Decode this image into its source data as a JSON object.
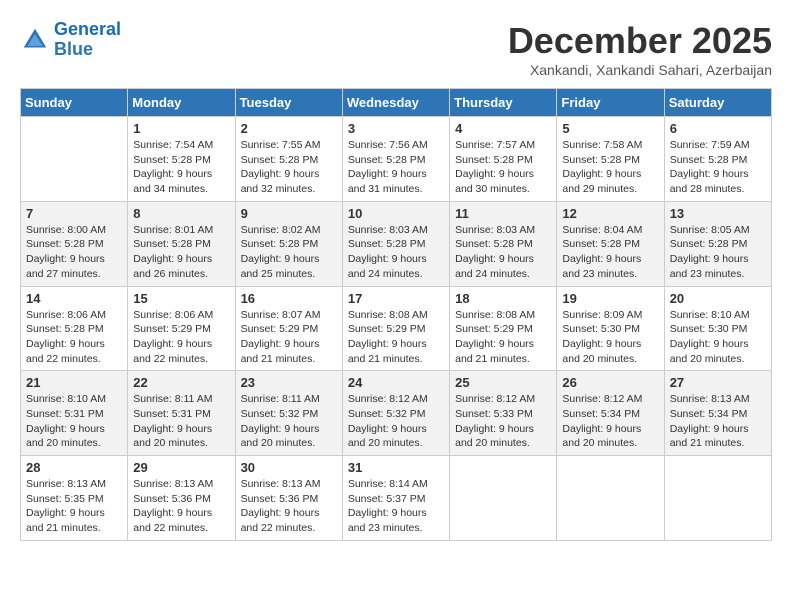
{
  "header": {
    "logo_line1": "General",
    "logo_line2": "Blue",
    "month": "December 2025",
    "location": "Xankandi, Xankandi Sahari, Azerbaijan"
  },
  "weekdays": [
    "Sunday",
    "Monday",
    "Tuesday",
    "Wednesday",
    "Thursday",
    "Friday",
    "Saturday"
  ],
  "weeks": [
    [
      {
        "day": "",
        "sunrise": "",
        "sunset": "",
        "daylight": ""
      },
      {
        "day": "1",
        "sunrise": "Sunrise: 7:54 AM",
        "sunset": "Sunset: 5:28 PM",
        "daylight": "Daylight: 9 hours and 34 minutes."
      },
      {
        "day": "2",
        "sunrise": "Sunrise: 7:55 AM",
        "sunset": "Sunset: 5:28 PM",
        "daylight": "Daylight: 9 hours and 32 minutes."
      },
      {
        "day": "3",
        "sunrise": "Sunrise: 7:56 AM",
        "sunset": "Sunset: 5:28 PM",
        "daylight": "Daylight: 9 hours and 31 minutes."
      },
      {
        "day": "4",
        "sunrise": "Sunrise: 7:57 AM",
        "sunset": "Sunset: 5:28 PM",
        "daylight": "Daylight: 9 hours and 30 minutes."
      },
      {
        "day": "5",
        "sunrise": "Sunrise: 7:58 AM",
        "sunset": "Sunset: 5:28 PM",
        "daylight": "Daylight: 9 hours and 29 minutes."
      },
      {
        "day": "6",
        "sunrise": "Sunrise: 7:59 AM",
        "sunset": "Sunset: 5:28 PM",
        "daylight": "Daylight: 9 hours and 28 minutes."
      }
    ],
    [
      {
        "day": "7",
        "sunrise": "Sunrise: 8:00 AM",
        "sunset": "Sunset: 5:28 PM",
        "daylight": "Daylight: 9 hours and 27 minutes."
      },
      {
        "day": "8",
        "sunrise": "Sunrise: 8:01 AM",
        "sunset": "Sunset: 5:28 PM",
        "daylight": "Daylight: 9 hours and 26 minutes."
      },
      {
        "day": "9",
        "sunrise": "Sunrise: 8:02 AM",
        "sunset": "Sunset: 5:28 PM",
        "daylight": "Daylight: 9 hours and 25 minutes."
      },
      {
        "day": "10",
        "sunrise": "Sunrise: 8:03 AM",
        "sunset": "Sunset: 5:28 PM",
        "daylight": "Daylight: 9 hours and 24 minutes."
      },
      {
        "day": "11",
        "sunrise": "Sunrise: 8:03 AM",
        "sunset": "Sunset: 5:28 PM",
        "daylight": "Daylight: 9 hours and 24 minutes."
      },
      {
        "day": "12",
        "sunrise": "Sunrise: 8:04 AM",
        "sunset": "Sunset: 5:28 PM",
        "daylight": "Daylight: 9 hours and 23 minutes."
      },
      {
        "day": "13",
        "sunrise": "Sunrise: 8:05 AM",
        "sunset": "Sunset: 5:28 PM",
        "daylight": "Daylight: 9 hours and 23 minutes."
      }
    ],
    [
      {
        "day": "14",
        "sunrise": "Sunrise: 8:06 AM",
        "sunset": "Sunset: 5:28 PM",
        "daylight": "Daylight: 9 hours and 22 minutes."
      },
      {
        "day": "15",
        "sunrise": "Sunrise: 8:06 AM",
        "sunset": "Sunset: 5:29 PM",
        "daylight": "Daylight: 9 hours and 22 minutes."
      },
      {
        "day": "16",
        "sunrise": "Sunrise: 8:07 AM",
        "sunset": "Sunset: 5:29 PM",
        "daylight": "Daylight: 9 hours and 21 minutes."
      },
      {
        "day": "17",
        "sunrise": "Sunrise: 8:08 AM",
        "sunset": "Sunset: 5:29 PM",
        "daylight": "Daylight: 9 hours and 21 minutes."
      },
      {
        "day": "18",
        "sunrise": "Sunrise: 8:08 AM",
        "sunset": "Sunset: 5:29 PM",
        "daylight": "Daylight: 9 hours and 21 minutes."
      },
      {
        "day": "19",
        "sunrise": "Sunrise: 8:09 AM",
        "sunset": "Sunset: 5:30 PM",
        "daylight": "Daylight: 9 hours and 20 minutes."
      },
      {
        "day": "20",
        "sunrise": "Sunrise: 8:10 AM",
        "sunset": "Sunset: 5:30 PM",
        "daylight": "Daylight: 9 hours and 20 minutes."
      }
    ],
    [
      {
        "day": "21",
        "sunrise": "Sunrise: 8:10 AM",
        "sunset": "Sunset: 5:31 PM",
        "daylight": "Daylight: 9 hours and 20 minutes."
      },
      {
        "day": "22",
        "sunrise": "Sunrise: 8:11 AM",
        "sunset": "Sunset: 5:31 PM",
        "daylight": "Daylight: 9 hours and 20 minutes."
      },
      {
        "day": "23",
        "sunrise": "Sunrise: 8:11 AM",
        "sunset": "Sunset: 5:32 PM",
        "daylight": "Daylight: 9 hours and 20 minutes."
      },
      {
        "day": "24",
        "sunrise": "Sunrise: 8:12 AM",
        "sunset": "Sunset: 5:32 PM",
        "daylight": "Daylight: 9 hours and 20 minutes."
      },
      {
        "day": "25",
        "sunrise": "Sunrise: 8:12 AM",
        "sunset": "Sunset: 5:33 PM",
        "daylight": "Daylight: 9 hours and 20 minutes."
      },
      {
        "day": "26",
        "sunrise": "Sunrise: 8:12 AM",
        "sunset": "Sunset: 5:34 PM",
        "daylight": "Daylight: 9 hours and 20 minutes."
      },
      {
        "day": "27",
        "sunrise": "Sunrise: 8:13 AM",
        "sunset": "Sunset: 5:34 PM",
        "daylight": "Daylight: 9 hours and 21 minutes."
      }
    ],
    [
      {
        "day": "28",
        "sunrise": "Sunrise: 8:13 AM",
        "sunset": "Sunset: 5:35 PM",
        "daylight": "Daylight: 9 hours and 21 minutes."
      },
      {
        "day": "29",
        "sunrise": "Sunrise: 8:13 AM",
        "sunset": "Sunset: 5:36 PM",
        "daylight": "Daylight: 9 hours and 22 minutes."
      },
      {
        "day": "30",
        "sunrise": "Sunrise: 8:13 AM",
        "sunset": "Sunset: 5:36 PM",
        "daylight": "Daylight: 9 hours and 22 minutes."
      },
      {
        "day": "31",
        "sunrise": "Sunrise: 8:14 AM",
        "sunset": "Sunset: 5:37 PM",
        "daylight": "Daylight: 9 hours and 23 minutes."
      },
      {
        "day": "",
        "sunrise": "",
        "sunset": "",
        "daylight": ""
      },
      {
        "day": "",
        "sunrise": "",
        "sunset": "",
        "daylight": ""
      },
      {
        "day": "",
        "sunrise": "",
        "sunset": "",
        "daylight": ""
      }
    ]
  ]
}
